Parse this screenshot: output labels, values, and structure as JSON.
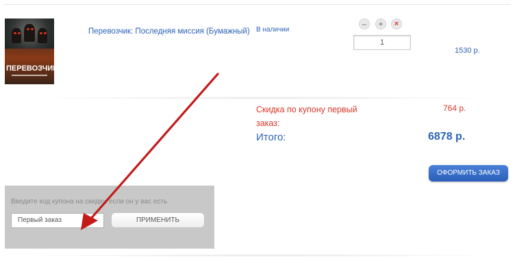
{
  "cart": {
    "item": {
      "title": "Перевозчик: Последняя миссия (Бумажный)",
      "cover_title": "ПЕРЕВОЗЧИК",
      "stock": "В наличии",
      "quantity": "1",
      "price": "1530 р.",
      "controls": {
        "minus_icon": "minus-icon",
        "plus_icon": "plus-icon",
        "remove_icon": "remove-icon"
      }
    },
    "minus_glyph": "–",
    "plus_glyph": "+",
    "remove_glyph": "×"
  },
  "totals": {
    "discount_label": "Скидка по купону первый заказ:",
    "discount_value": "764 р.",
    "total_label": "Итого:",
    "total_value": "6878 р."
  },
  "order_button": "ОФОРМИТЬ ЗАКАЗ",
  "coupon": {
    "hint": "Введите код купона на скидку, если он у вас есть",
    "value": "Первый заказ",
    "apply_label": "ПРИМЕНИТЬ"
  },
  "colors": {
    "link": "#2b62b5",
    "discount": "#d9372a",
    "order_button": "#2a5fb8",
    "coupon_panel": "#c8c8c8",
    "annotation_arrow": "#c41a1a"
  }
}
